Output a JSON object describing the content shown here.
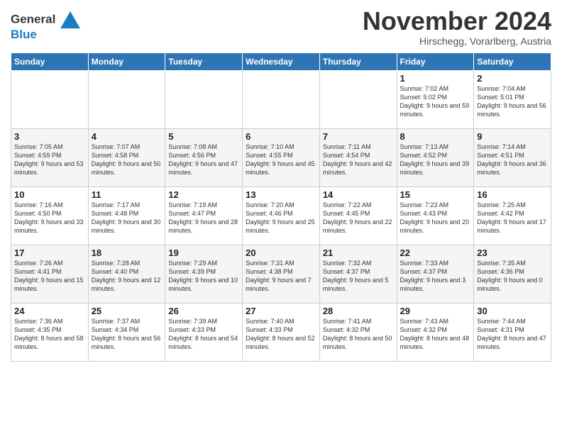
{
  "header": {
    "logo_line1": "General",
    "logo_line2": "Blue",
    "month_title": "November 2024",
    "location": "Hirschegg, Vorarlberg, Austria"
  },
  "weekdays": [
    "Sunday",
    "Monday",
    "Tuesday",
    "Wednesday",
    "Thursday",
    "Friday",
    "Saturday"
  ],
  "weeks": [
    [
      {
        "day": "",
        "info": ""
      },
      {
        "day": "",
        "info": ""
      },
      {
        "day": "",
        "info": ""
      },
      {
        "day": "",
        "info": ""
      },
      {
        "day": "",
        "info": ""
      },
      {
        "day": "1",
        "info": "Sunrise: 7:02 AM\nSunset: 5:02 PM\nDaylight: 9 hours and 59 minutes."
      },
      {
        "day": "2",
        "info": "Sunrise: 7:04 AM\nSunset: 5:01 PM\nDaylight: 9 hours and 56 minutes."
      }
    ],
    [
      {
        "day": "3",
        "info": "Sunrise: 7:05 AM\nSunset: 4:59 PM\nDaylight: 9 hours and 53 minutes."
      },
      {
        "day": "4",
        "info": "Sunrise: 7:07 AM\nSunset: 4:58 PM\nDaylight: 9 hours and 50 minutes."
      },
      {
        "day": "5",
        "info": "Sunrise: 7:08 AM\nSunset: 4:56 PM\nDaylight: 9 hours and 47 minutes."
      },
      {
        "day": "6",
        "info": "Sunrise: 7:10 AM\nSunset: 4:55 PM\nDaylight: 9 hours and 45 minutes."
      },
      {
        "day": "7",
        "info": "Sunrise: 7:11 AM\nSunset: 4:54 PM\nDaylight: 9 hours and 42 minutes."
      },
      {
        "day": "8",
        "info": "Sunrise: 7:13 AM\nSunset: 4:52 PM\nDaylight: 9 hours and 39 minutes."
      },
      {
        "day": "9",
        "info": "Sunrise: 7:14 AM\nSunset: 4:51 PM\nDaylight: 9 hours and 36 minutes."
      }
    ],
    [
      {
        "day": "10",
        "info": "Sunrise: 7:16 AM\nSunset: 4:50 PM\nDaylight: 9 hours and 33 minutes."
      },
      {
        "day": "11",
        "info": "Sunrise: 7:17 AM\nSunset: 4:48 PM\nDaylight: 9 hours and 30 minutes."
      },
      {
        "day": "12",
        "info": "Sunrise: 7:19 AM\nSunset: 4:47 PM\nDaylight: 9 hours and 28 minutes."
      },
      {
        "day": "13",
        "info": "Sunrise: 7:20 AM\nSunset: 4:46 PM\nDaylight: 9 hours and 25 minutes."
      },
      {
        "day": "14",
        "info": "Sunrise: 7:22 AM\nSunset: 4:45 PM\nDaylight: 9 hours and 22 minutes."
      },
      {
        "day": "15",
        "info": "Sunrise: 7:23 AM\nSunset: 4:43 PM\nDaylight: 9 hours and 20 minutes."
      },
      {
        "day": "16",
        "info": "Sunrise: 7:25 AM\nSunset: 4:42 PM\nDaylight: 9 hours and 17 minutes."
      }
    ],
    [
      {
        "day": "17",
        "info": "Sunrise: 7:26 AM\nSunset: 4:41 PM\nDaylight: 9 hours and 15 minutes."
      },
      {
        "day": "18",
        "info": "Sunrise: 7:28 AM\nSunset: 4:40 PM\nDaylight: 9 hours and 12 minutes."
      },
      {
        "day": "19",
        "info": "Sunrise: 7:29 AM\nSunset: 4:39 PM\nDaylight: 9 hours and 10 minutes."
      },
      {
        "day": "20",
        "info": "Sunrise: 7:31 AM\nSunset: 4:38 PM\nDaylight: 9 hours and 7 minutes."
      },
      {
        "day": "21",
        "info": "Sunrise: 7:32 AM\nSunset: 4:37 PM\nDaylight: 9 hours and 5 minutes."
      },
      {
        "day": "22",
        "info": "Sunrise: 7:33 AM\nSunset: 4:37 PM\nDaylight: 9 hours and 3 minutes."
      },
      {
        "day": "23",
        "info": "Sunrise: 7:35 AM\nSunset: 4:36 PM\nDaylight: 9 hours and 0 minutes."
      }
    ],
    [
      {
        "day": "24",
        "info": "Sunrise: 7:36 AM\nSunset: 4:35 PM\nDaylight: 8 hours and 58 minutes."
      },
      {
        "day": "25",
        "info": "Sunrise: 7:37 AM\nSunset: 4:34 PM\nDaylight: 8 hours and 56 minutes."
      },
      {
        "day": "26",
        "info": "Sunrise: 7:39 AM\nSunset: 4:33 PM\nDaylight: 8 hours and 54 minutes."
      },
      {
        "day": "27",
        "info": "Sunrise: 7:40 AM\nSunset: 4:33 PM\nDaylight: 8 hours and 52 minutes."
      },
      {
        "day": "28",
        "info": "Sunrise: 7:41 AM\nSunset: 4:32 PM\nDaylight: 8 hours and 50 minutes."
      },
      {
        "day": "29",
        "info": "Sunrise: 7:43 AM\nSunset: 4:32 PM\nDaylight: 8 hours and 48 minutes."
      },
      {
        "day": "30",
        "info": "Sunrise: 7:44 AM\nSunset: 4:31 PM\nDaylight: 8 hours and 47 minutes."
      }
    ]
  ]
}
